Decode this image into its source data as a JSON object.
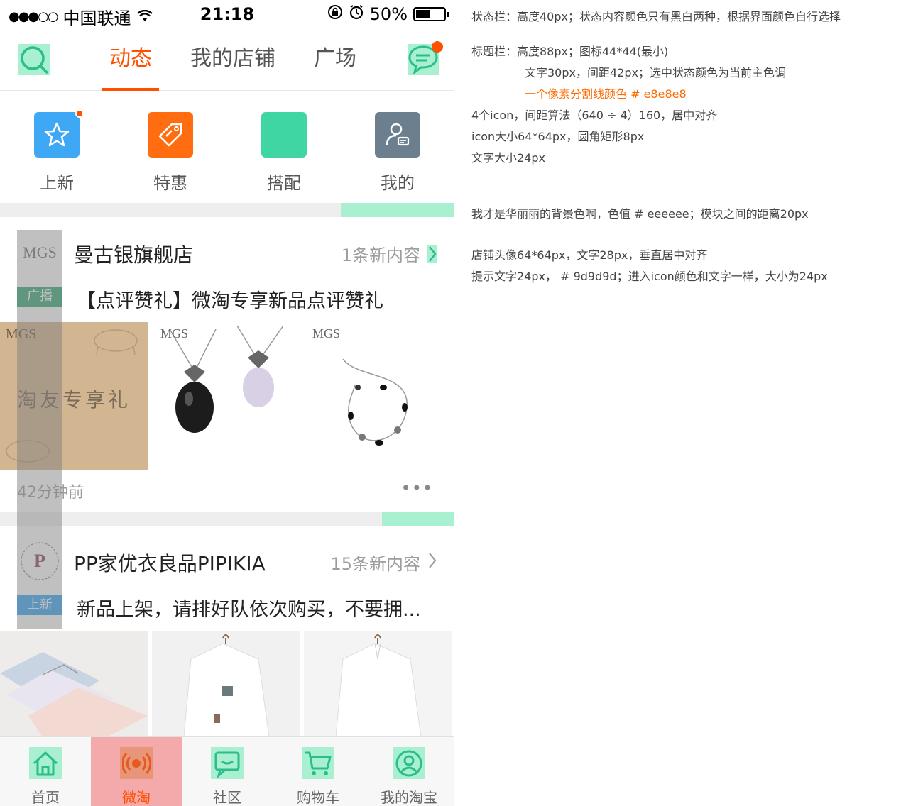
{
  "status_bar": {
    "signal": "●●●○○",
    "carrier": "中国联通",
    "time": "21:18",
    "battery_text": "50%",
    "battery_level": 0.5
  },
  "title_bar": {
    "tabs": [
      {
        "label": "动态",
        "active": true
      },
      {
        "label": "我的店铺",
        "active": false
      },
      {
        "label": "广场",
        "active": false
      }
    ],
    "icons": [
      "search-icon",
      "message-icon"
    ]
  },
  "quick_entries": [
    {
      "label": "上新",
      "color": "#3ea8f5",
      "icon": "star-icon",
      "badge": true
    },
    {
      "label": "特惠",
      "color": "#ff6d10",
      "icon": "tag-icon",
      "badge": false
    },
    {
      "label": "搭配",
      "color": "#3fd6a4",
      "icon": "blank-icon",
      "badge": false
    },
    {
      "label": "我的",
      "color": "#6b7f8f",
      "icon": "user-card-icon",
      "badge": false
    }
  ],
  "feed": [
    {
      "shop_name": "曼古银旗舰店",
      "avatar_text": "MGS",
      "tip": "1条新内容",
      "tag": "广播",
      "tag_color": "#3aaa7a",
      "title": "【点评赞礼】微淘专享新品点评赞礼",
      "images": [
        {
          "brand": "MGS",
          "caption": "淘友专享礼"
        },
        {
          "brand": "MGS",
          "caption": ""
        },
        {
          "brand": "MGS",
          "caption": ""
        }
      ],
      "time": "42分钟前",
      "more": "•••"
    },
    {
      "shop_name": "PP家优衣良品PIPIKIA",
      "avatar_text": "P",
      "tip": "15条新内容",
      "tag": "上新",
      "tag_color": "#3ea8f5",
      "title": "新品上架，请排好队依次购买，不要拥..."
    }
  ],
  "tab_bar": [
    {
      "label": "首页",
      "icon": "home-icon",
      "active": false
    },
    {
      "label": "微淘",
      "icon": "broadcast-icon",
      "active": true
    },
    {
      "label": "社区",
      "icon": "chat-icon",
      "active": false
    },
    {
      "label": "购物车",
      "icon": "cart-icon",
      "active": false
    },
    {
      "label": "我的淘宝",
      "icon": "profile-icon",
      "active": false
    }
  ],
  "notes": [
    {
      "text": "状态栏：高度40px；状态内容颜色只有黑白两种，根据界面颜色自行选择",
      "color": "#444444"
    },
    {
      "text": "标题栏：高度88px；图标44*44(最小)",
      "color": "#444444"
    },
    {
      "text": "文字30px，间距42px；选中状态颜色为当前主色调",
      "color": "#444444"
    },
    {
      "text": "一个像素分割线颜色 # e8e8e8",
      "color": "#ff6a00"
    },
    {
      "text": "4个icon，间距算法（640 ÷ 4）160，居中对齐",
      "color": "#444444"
    },
    {
      "text": "icon大小64*64px，圆角矩形8px",
      "color": "#444444"
    },
    {
      "text": "文字大小24px",
      "color": "#444444"
    },
    {
      "text": "我才是华丽丽的背景色啊，色值 # eeeeee；模块之间的距离20px",
      "color": "#444444"
    },
    {
      "text": "店铺头像64*64px，文字28px，垂直居中对齐",
      "color": "#444444"
    },
    {
      "text": "提示文字24px，  # 9d9d9d；进入icon颜色和文字一样，大小为24px",
      "color": "#444444"
    }
  ]
}
